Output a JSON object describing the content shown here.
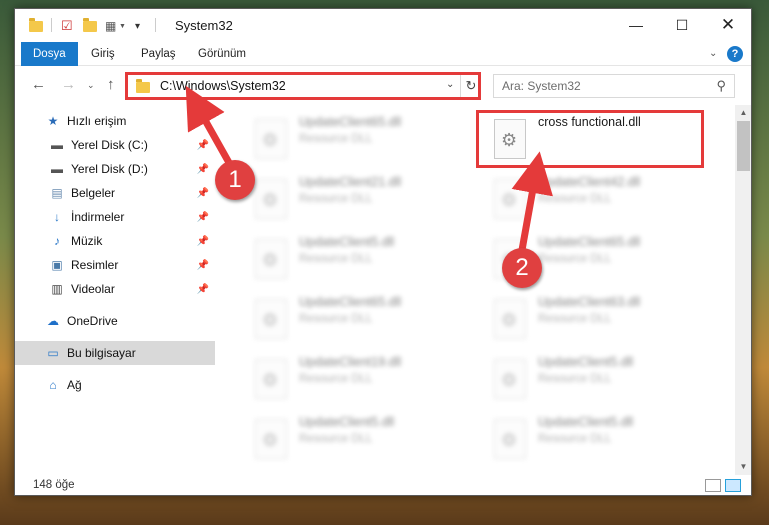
{
  "window": {
    "title": "System32"
  },
  "ribbon": {
    "tabs": [
      {
        "label": "Dosya"
      },
      {
        "label": "Giriş"
      },
      {
        "label": "Paylaş"
      },
      {
        "label": "Görünüm"
      }
    ]
  },
  "address": {
    "path": "C:\\Windows\\System32"
  },
  "search": {
    "placeholder": "Ara: System32"
  },
  "nav": {
    "quick_access": "Hızlı erişim",
    "items": [
      {
        "label": "Yerel Disk (C:)",
        "icon": "drive-icon"
      },
      {
        "label": "Yerel Disk (D:)",
        "icon": "drive-icon"
      },
      {
        "label": "Belgeler",
        "icon": "documents-icon"
      },
      {
        "label": "İndirmeler",
        "icon": "downloads-icon"
      },
      {
        "label": "Müzik",
        "icon": "music-icon"
      },
      {
        "label": "Resimler",
        "icon": "pictures-icon"
      },
      {
        "label": "Videolar",
        "icon": "videos-icon"
      }
    ],
    "onedrive": "OneDrive",
    "this_pc": "Bu bilgisayar",
    "network": "Ağ"
  },
  "files": {
    "left": [
      {
        "name": "UpdateClient65.dll",
        "type": "Resource DLL"
      },
      {
        "name": "UpdateClient21.dll",
        "type": "Resource DLL"
      },
      {
        "name": "UpdateClient5.dll",
        "type": "Resource DLL"
      },
      {
        "name": "UpdateClient65.dll",
        "type": "Resource DLL"
      },
      {
        "name": "UpdateClient19.dll",
        "type": "Resource DLL"
      },
      {
        "name": "UpdateClient5.dll",
        "type": "Resource DLL"
      }
    ],
    "right": [
      {
        "name": "cross functional.dll",
        "type": ""
      },
      {
        "name": "UpdateClient42.dll",
        "type": "Resource DLL"
      },
      {
        "name": "UpdateClient65.dll",
        "type": "Resource DLL"
      },
      {
        "name": "UpdateClient63.dll",
        "type": "Resource DLL"
      },
      {
        "name": "UpdateClient5.dll",
        "type": "Resource DLL"
      },
      {
        "name": "UpdateClient5.dll",
        "type": "Resource DLL"
      }
    ]
  },
  "status": {
    "count": "148 öğe"
  },
  "annotations": {
    "badge1": "1",
    "badge2": "2",
    "color": "#e43a3a"
  }
}
